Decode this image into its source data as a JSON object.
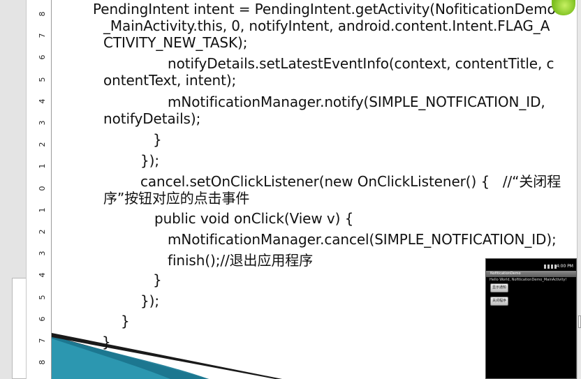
{
  "ruler": {
    "labels": [
      {
        "text": "8",
        "mark": "8"
      },
      {
        "text": "7",
        "mark": "7"
      },
      {
        "text": "6",
        "mark": "6"
      },
      {
        "text": "5",
        "mark": "5"
      },
      {
        "text": "4",
        "mark": "4"
      },
      {
        "text": "3",
        "mark": "3"
      },
      {
        "text": "2",
        "mark": "2"
      },
      {
        "text": "1",
        "mark": "1"
      },
      {
        "text": "0",
        "mark": "0"
      },
      {
        "text": "1",
        "mark": "1b"
      },
      {
        "text": "2",
        "mark": "2b"
      },
      {
        "text": "3",
        "mark": "3b"
      },
      {
        "text": "4",
        "mark": "4b"
      },
      {
        "text": "5",
        "mark": "5b"
      },
      {
        "text": "6",
        "mark": "6b"
      },
      {
        "text": "7",
        "mark": "7b"
      },
      {
        "text": "8",
        "mark": "8b"
      }
    ]
  },
  "slide": {
    "code_lines": [
      "PendingIntent intent = PendingIntent.getActivity(NofiticationDemo",
      "_MainActivity.this, 0, notifyIntent, android.content.Intent.FLAG_A",
      "CTIVITY_NEW_TASK);",
      "notifyDetails.setLatestEventInfo(context, contentTitle, c",
      "ontentText, intent);",
      "mNotificationManager.notify(SIMPLE_NOTFICATION_ID,",
      "notifyDetails);",
      "}",
      "});",
      "cancel.setOnClickListener(new OnClickListener() {   //“关闭程",
      "序”按钮对应的点击事件",
      "public void onClick(View v) {",
      "mNotificationManager.cancel(SIMPLE_NOTFICATION_ID);",
      "finish();//退出应用程序",
      "}",
      "});",
      "}",
      "}"
    ]
  },
  "emulator": {
    "status_time": "4:00 PM",
    "title": "NofiticationDemo",
    "hello_text": "Hello World, NofiticationDemo_MainActivity!",
    "show_button_label": "显示通知",
    "close_button_label": "关闭程序"
  },
  "colors": {
    "slide_background": "#ffffff",
    "code_text": "#111111",
    "swoosh_dark": "#0a0a0a",
    "swoosh_teal": "#1d7d98",
    "accent_green": "#8bcf2a"
  }
}
